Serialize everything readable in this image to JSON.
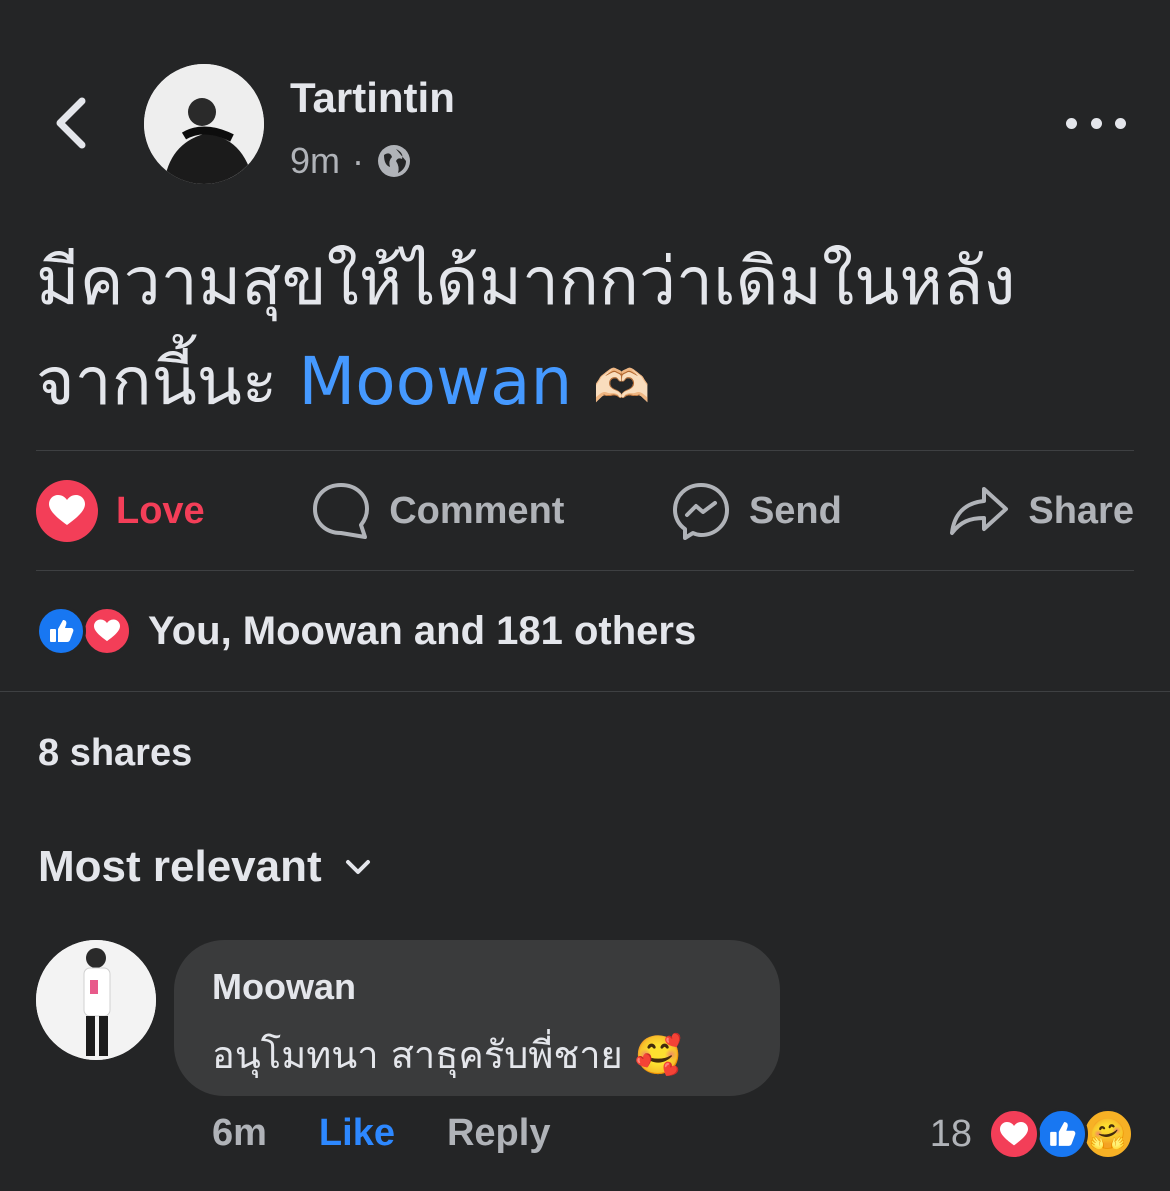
{
  "post": {
    "author": "Tartintin",
    "time": "9m",
    "separator": "·",
    "text_line1": "มีความสุขให้ได้มากกว่าเดิมในหลัง",
    "text_line2_prefix": "จากนี้นะ ",
    "mention": "Moowan",
    "emoji": "🫶🏻"
  },
  "actions": {
    "love": "Love",
    "comment": "Comment",
    "send": "Send",
    "share": "Share"
  },
  "reactions": {
    "summary": "You, Moowan and 181 others"
  },
  "shares": "8 shares",
  "sort": {
    "label": "Most relevant"
  },
  "comment": {
    "author": "Moowan",
    "text": "อนุโมทนา สาธุครับพี่ชาย",
    "emoji": "🥰",
    "time": "6m",
    "like": "Like",
    "reply": "Reply",
    "reaction_count": "18",
    "care_emoji": "🤗"
  },
  "colors": {
    "background": "#242526",
    "love": "#f33e58",
    "like": "#1877f2",
    "mention": "#4599ff"
  },
  "icons": [
    "back-arrow-icon",
    "globe-icon",
    "more-icon",
    "love-reaction-icon",
    "comment-icon",
    "messenger-icon",
    "share-arrow-icon",
    "like-reaction-icon",
    "chevron-down-icon",
    "care-reaction-icon"
  ]
}
